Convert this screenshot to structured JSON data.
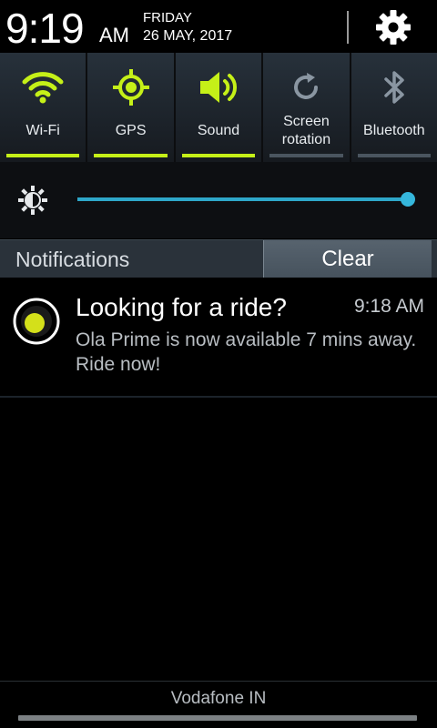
{
  "status_header": {
    "time": "9:19",
    "ampm": "AM",
    "day": "FRIDAY",
    "date": "26 MAY, 2017",
    "settings_icon": "gear-icon"
  },
  "quick_toggles": [
    {
      "label": "Wi-Fi",
      "icon": "wifi-icon",
      "active": true
    },
    {
      "label": "GPS",
      "icon": "gps-icon",
      "active": true
    },
    {
      "label": "Sound",
      "icon": "speaker-icon",
      "active": true
    },
    {
      "label": "Screen\nrotation",
      "icon": "rotation-icon",
      "active": false
    },
    {
      "label": "Bluetooth",
      "icon": "bluetooth-icon",
      "active": false
    }
  ],
  "brightness": {
    "icon": "brightness-icon",
    "level": 1.0
  },
  "notifications": {
    "header_label": "Notifications",
    "clear_label": "Clear",
    "items": [
      {
        "app_icon": "ola-app-icon",
        "title": "Looking for a ride?",
        "time": "9:18 AM",
        "body": "Ola Prime is now available 7 mins away. Ride now!"
      }
    ]
  },
  "carrier": "Vodafone IN",
  "colors": {
    "accent_active": "#c5f018",
    "inactive_icon": "#8a96a2",
    "slider": "#2ea7c9",
    "ola_yellow": "#d4e01a"
  }
}
